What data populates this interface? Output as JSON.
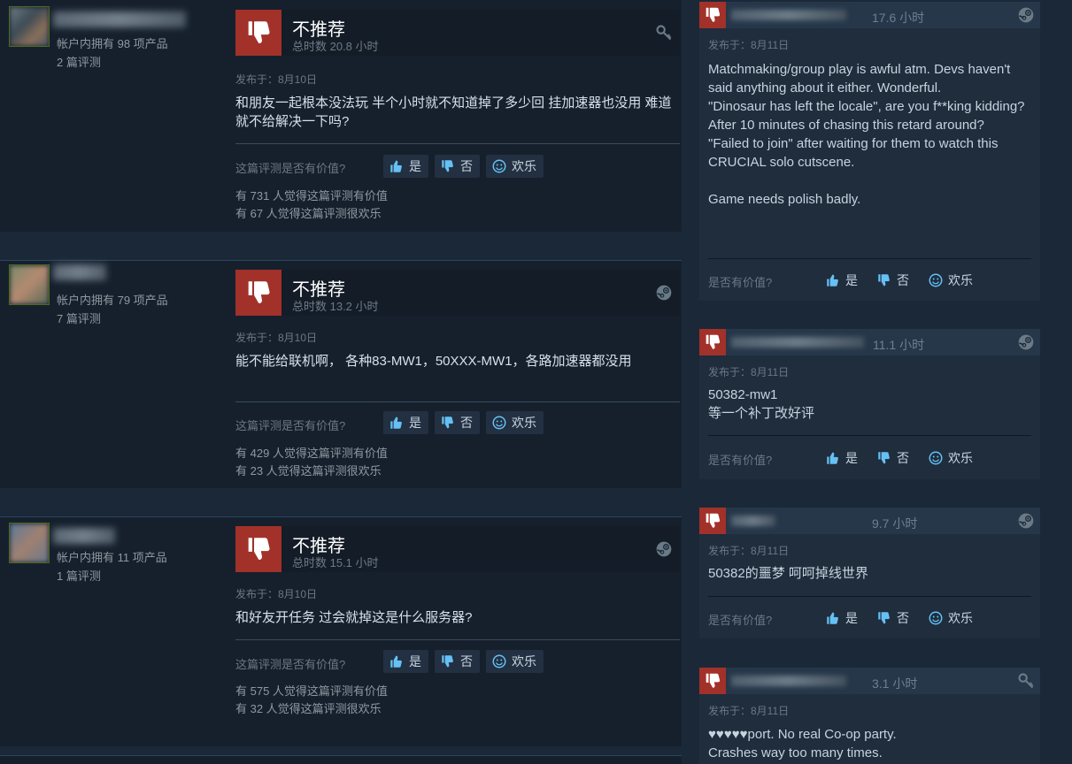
{
  "ui": {
    "helpful_question": "这篇评测是否有价值?",
    "helpful_question_short": "是否有价值?",
    "btn_yes": "是",
    "btn_no": "否",
    "btn_funny": "欢乐"
  },
  "left_reviews": [
    {
      "user": {
        "owned": "帐户内拥有 98 项产品",
        "reviews": "2 篇评测"
      },
      "verdict": "不推荐",
      "hours": "总时数 20.8 小时",
      "posted": "发布于：8月10日",
      "body": "和朋友一起根本没法玩 半个小时就不知道掉了多少回 挂加速器也没用 难道就不给解决一下吗?",
      "helpful_count": "有 731 人觉得这篇评测有价值",
      "funny_count": "有 67 人觉得这篇评测很欢乐",
      "icon": "key-icon"
    },
    {
      "user": {
        "owned": "帐户内拥有 79 项产品",
        "reviews": "7 篇评测"
      },
      "verdict": "不推荐",
      "hours": "总时数 13.2 小时",
      "posted": "发布于：8月10日",
      "body": "能不能给联机啊， 各种83-MW1，50XXX-MW1，各路加速器都没用",
      "helpful_count": "有 429 人觉得这篇评测有价值",
      "funny_count": "有 23 人觉得这篇评测很欢乐",
      "icon": "steam-icon"
    },
    {
      "user": {
        "owned": "帐户内拥有 11 项产品",
        "reviews": "1 篇评测"
      },
      "verdict": "不推荐",
      "hours": "总时数 15.1 小时",
      "posted": "发布于：8月10日",
      "body": "和好友开任务 过会就掉这是什么服务器?",
      "helpful_count": "有 575 人觉得这篇评测有价值",
      "funny_count": "有 32 人觉得这篇评测很欢乐",
      "icon": "steam-icon"
    }
  ],
  "right_reviews": [
    {
      "hours": "17.6 小时",
      "posted": "发布于：8月11日",
      "body_lines": [
        "Matchmaking/group play is awful atm. Devs haven't said anything about it either. Wonderful.",
        "\"Dinosaur has left the locale\", are you f**king kidding? After 10 minutes of chasing this retard around?",
        "\"Failed to join\" after waiting for them to watch this CRUCIAL solo cutscene.",
        "",
        "Game needs polish badly."
      ],
      "icon": "steam-icon"
    },
    {
      "hours": "11.1 小时",
      "posted": "发布于：8月11日",
      "body_lines": [
        "50382-mw1",
        "等一个补丁改好评"
      ],
      "icon": "steam-icon"
    },
    {
      "hours": "9.7 小时",
      "posted": "发布于：8月11日",
      "body_lines": [
        "50382的噩梦 呵呵掉线世界"
      ],
      "icon": "steam-icon"
    },
    {
      "hours": "3.1 小时",
      "posted": "发布于：8月11日",
      "body_lines": [
        "♥♥♥♥♥port. No real Co-op party.",
        "Crashes way too many times."
      ],
      "icon": "key-icon"
    }
  ],
  "colors": {
    "background": "#1b2838",
    "not_recommended": "#a2312a",
    "link_blue": "#66c0f4"
  }
}
